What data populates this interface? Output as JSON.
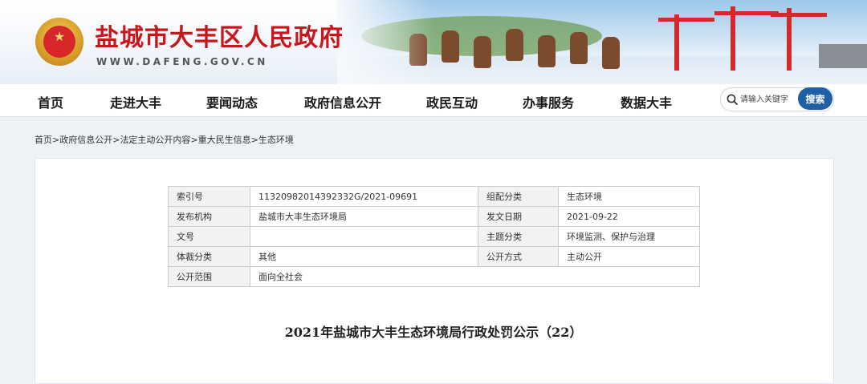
{
  "site": {
    "title": "盐城市大丰区人民政府",
    "domain": "WWW.DAFENG.GOV.CN"
  },
  "nav": {
    "items": [
      {
        "label": "首页"
      },
      {
        "label": "走进大丰"
      },
      {
        "label": "要闻动态"
      },
      {
        "label": "政府信息公开"
      },
      {
        "label": "政民互动"
      },
      {
        "label": "办事服务"
      },
      {
        "label": "数据大丰"
      }
    ]
  },
  "search": {
    "placeholder": "请输入关键字",
    "button_label": "搜索"
  },
  "breadcrumb": [
    "首页",
    "政府信息公开",
    "法定主动公开内容",
    "重大民生信息",
    "生态环境"
  ],
  "breadcrumb_sep": ">",
  "meta": {
    "rows": [
      [
        "索引号",
        "11320982014392332G/2021-09691",
        "组配分类",
        "生态环境"
      ],
      [
        "发布机构",
        "盐城市大丰生态环境局",
        "发文日期",
        "2021-09-22"
      ],
      [
        "文号",
        "",
        "主题分类",
        "环境监测、保护与治理"
      ],
      [
        "体裁分类",
        "其他",
        "公开方式",
        "主动公开"
      ],
      [
        "公开范围",
        "面向全社会"
      ]
    ]
  },
  "document": {
    "title": "2021年盐城市大丰生态环境局行政处罚公示（22）"
  },
  "colors": {
    "brand_red": "#c8161d",
    "search_button": "#1f5fa6"
  }
}
